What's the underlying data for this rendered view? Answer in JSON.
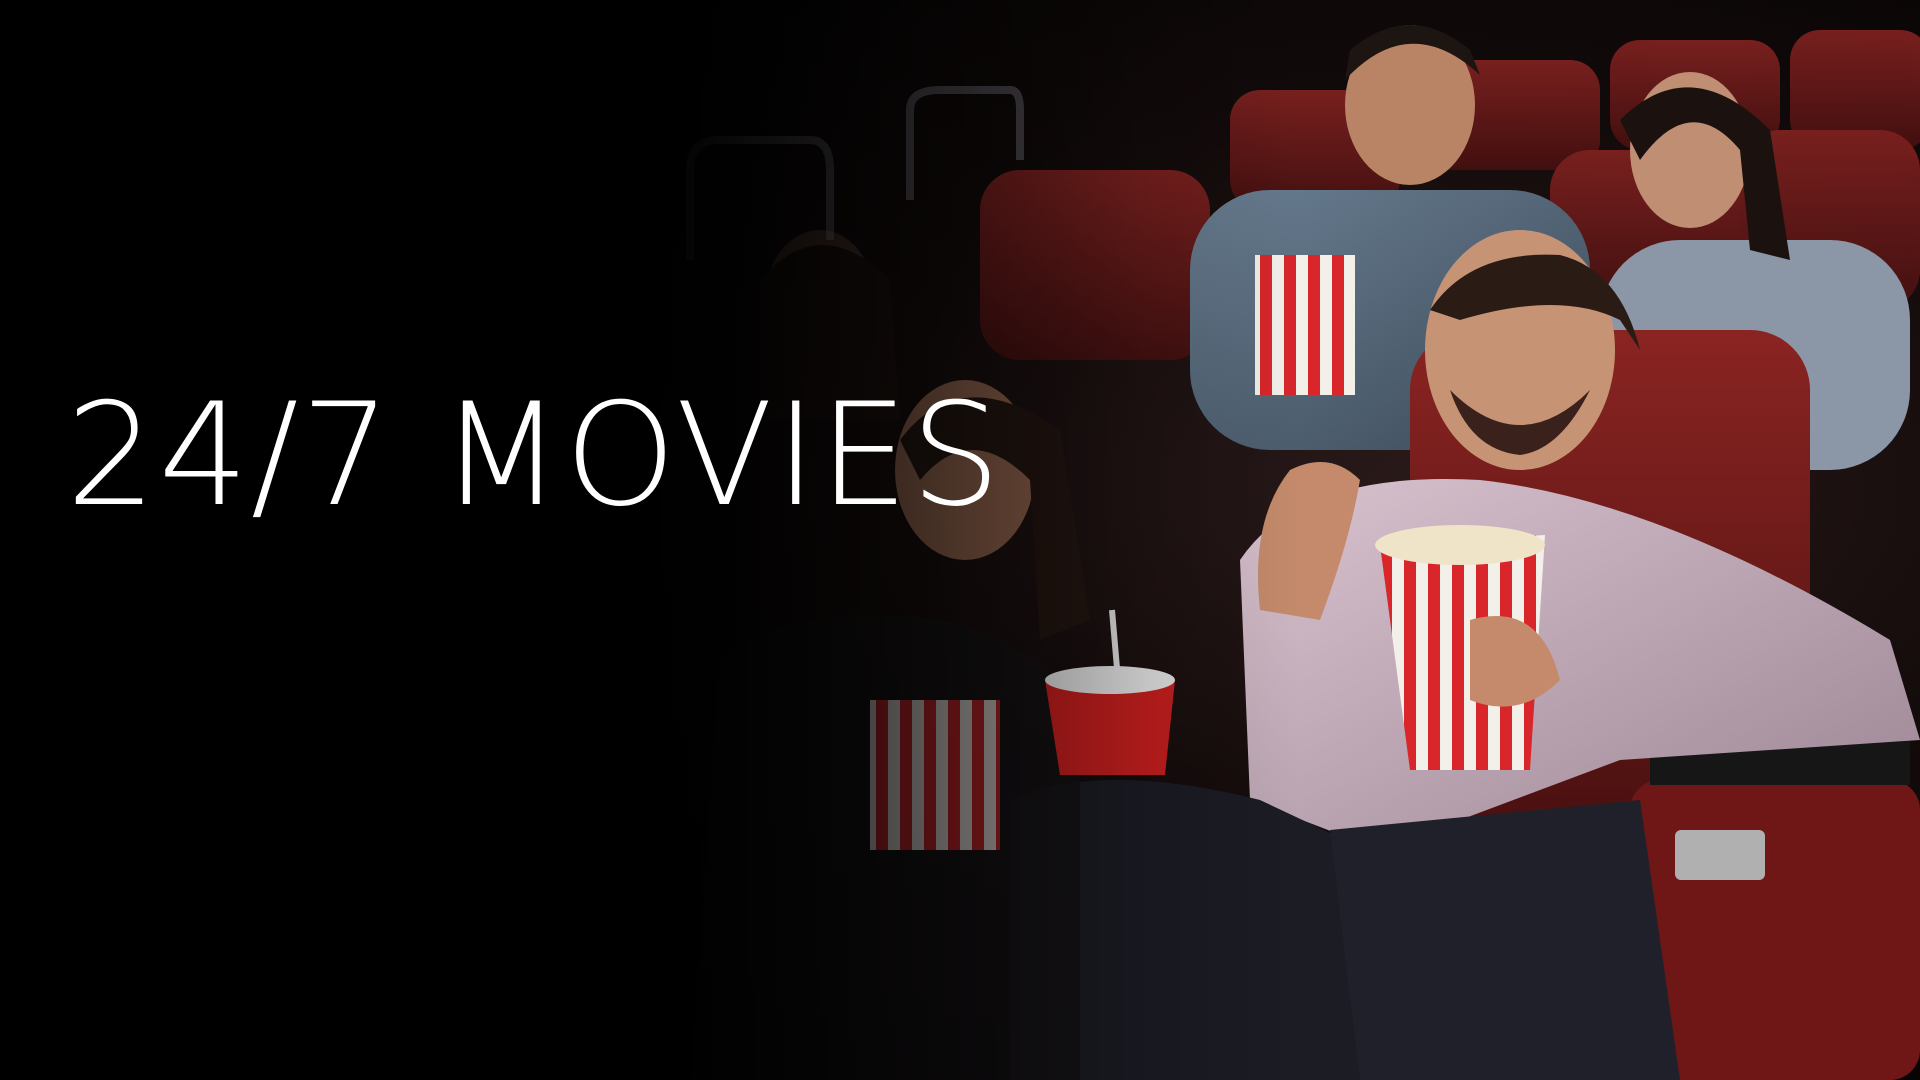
{
  "hero": {
    "title": "24/7 MOVIES",
    "title_color": "#ffffff",
    "background_color": "#000000"
  },
  "scene": {
    "description_icons": [
      "cinema-seat-icon",
      "popcorn-box-icon",
      "soda-cup-icon"
    ],
    "seat_color": "#8a1c1c",
    "popcorn_stripe_color": "#d8262b",
    "cup_color": "#c41e1e"
  }
}
